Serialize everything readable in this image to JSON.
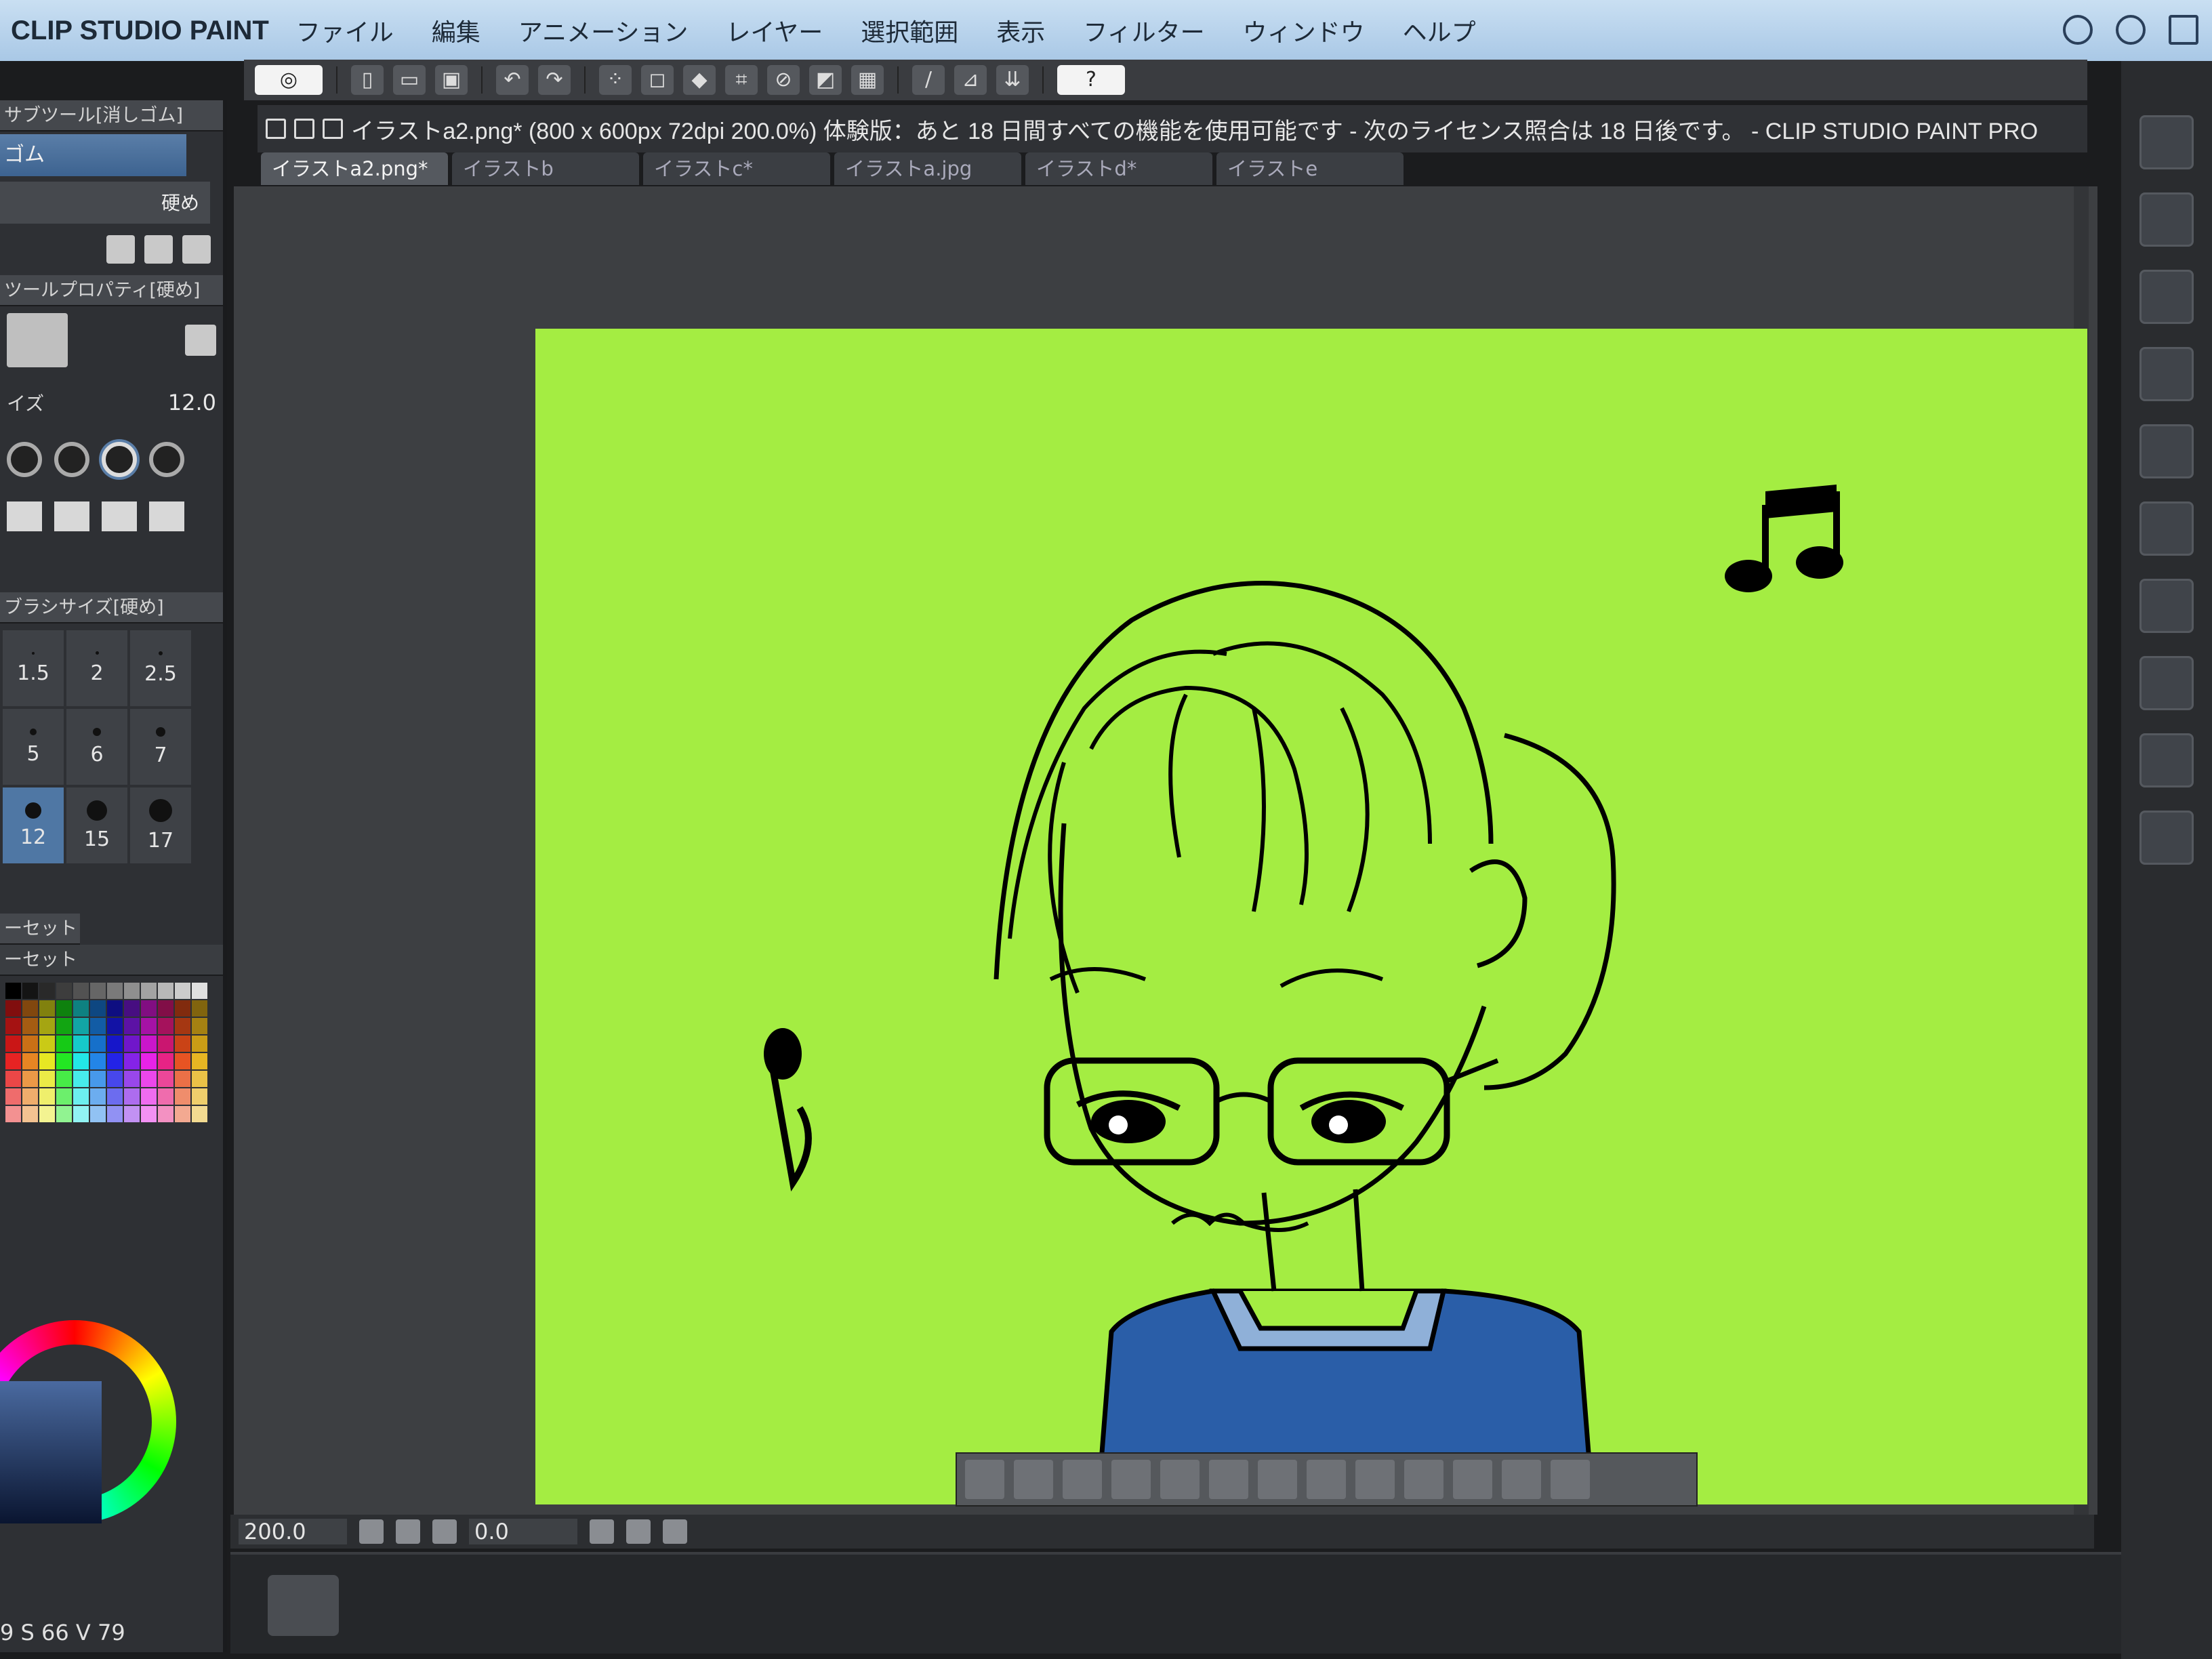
{
  "app": {
    "name": "CLIP STUDIO PAINT",
    "menu": [
      "ファイル",
      "編集",
      "アニメーション",
      "レイヤー",
      "選択範囲",
      "表示",
      "フィルター",
      "ウィンドウ",
      "ヘルプ"
    ]
  },
  "document": {
    "title": "イラストa2.png* (800 x 600px 72dpi 200.0%)  体験版：あと 18 日間すべての機能を使用可能です - 次のライセンス照合は 18 日後です。 - CLIP STUDIO PAINT PRO",
    "tabs": [
      "イラストa2.png*",
      "イラストb",
      "イラストc*",
      "イラストa.jpg",
      "イラストd*",
      "イラストe"
    ],
    "active_tab": 0,
    "canvas_color": "#a4ed42"
  },
  "left_dock": {
    "subtool_title": "サブツール[消しゴム]",
    "subtool_selected": "ゴム",
    "brush_name": "硬め",
    "tool_property_title": "ツールプロパティ[硬め]",
    "size_label": "イズ",
    "size_value": "12.0",
    "brush_size_title": "ブラシサイズ[硬め]",
    "brush_sizes": [
      "1.5",
      "2",
      "2.5",
      "5",
      "6",
      "7",
      "12",
      "15",
      "17"
    ],
    "brush_selected": "12",
    "color_set_tab": "ーセット",
    "color_set_name": "ーセット",
    "hsv_readout": "9 S 66 V 79"
  },
  "status": {
    "zoom": "200.0",
    "rotation": "0.0"
  },
  "colors": {
    "accent": "#4f77a4",
    "menubar": "#b6d2ec",
    "panel": "#2e3034",
    "canvas_bg": "#3d3f42",
    "shirt": "#2a5ea8",
    "collar": "#8fb0d8",
    "line": "#000000"
  }
}
